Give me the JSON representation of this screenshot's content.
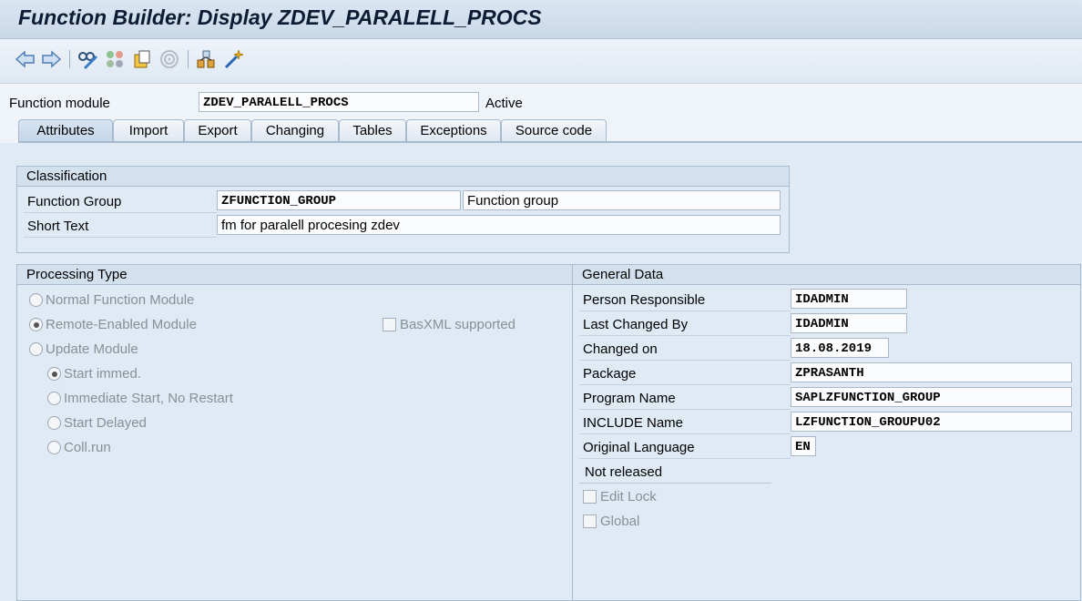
{
  "window": {
    "title": "Function Builder: Display ZDEV_PARALELL_PROCS"
  },
  "toolbar": {
    "icons": [
      "back-arrow-icon",
      "forward-arrow-icon",
      "other-object-icon",
      "display-change-icon",
      "activate-icon",
      "where-used-icon",
      "object-list-icon",
      "test-icon"
    ]
  },
  "header": {
    "function_module_label": "Function module",
    "function_module_value": "ZDEV_PARALELL_PROCS",
    "status": "Active"
  },
  "tabs": [
    {
      "label": "Attributes",
      "active": true
    },
    {
      "label": "Import"
    },
    {
      "label": "Export"
    },
    {
      "label": "Changing"
    },
    {
      "label": "Tables"
    },
    {
      "label": "Exceptions"
    },
    {
      "label": "Source code"
    }
  ],
  "classification": {
    "title": "Classification",
    "function_group_label": "Function Group",
    "function_group_value": "ZFUNCTION_GROUP",
    "function_group_desc": "Function group",
    "short_text_label": "Short Text",
    "short_text_value": "fm for paralell procesing zdev"
  },
  "processing_type": {
    "title": "Processing Type",
    "normal": "Normal Function Module",
    "remote": "Remote-Enabled Module",
    "basxml": "BasXML supported",
    "update": "Update Module",
    "start_immed": "Start immed.",
    "immediate_no_restart": "Immediate Start, No Restart",
    "start_delayed": "Start Delayed",
    "coll_run": "Coll.run",
    "selected": "Remote-Enabled Module",
    "selected_update": "Start immed."
  },
  "general_data": {
    "title": "General Data",
    "person_responsible_label": "Person Responsible",
    "person_responsible_value": "IDADMIN",
    "last_changed_by_label": "Last Changed By",
    "last_changed_by_value": "IDADMIN",
    "changed_on_label": "Changed on",
    "changed_on_value": "18.08.2019",
    "package_label": "Package",
    "package_value": "ZPRASANTH",
    "program_name_label": "Program Name",
    "program_name_value": "SAPLZFUNCTION_GROUP",
    "include_name_label": "INCLUDE Name",
    "include_name_value": "LZFUNCTION_GROUPU02",
    "original_language_label": "Original Language",
    "original_language_value": "EN",
    "release_status": "Not released",
    "edit_lock": "Edit Lock",
    "global": "Global"
  }
}
